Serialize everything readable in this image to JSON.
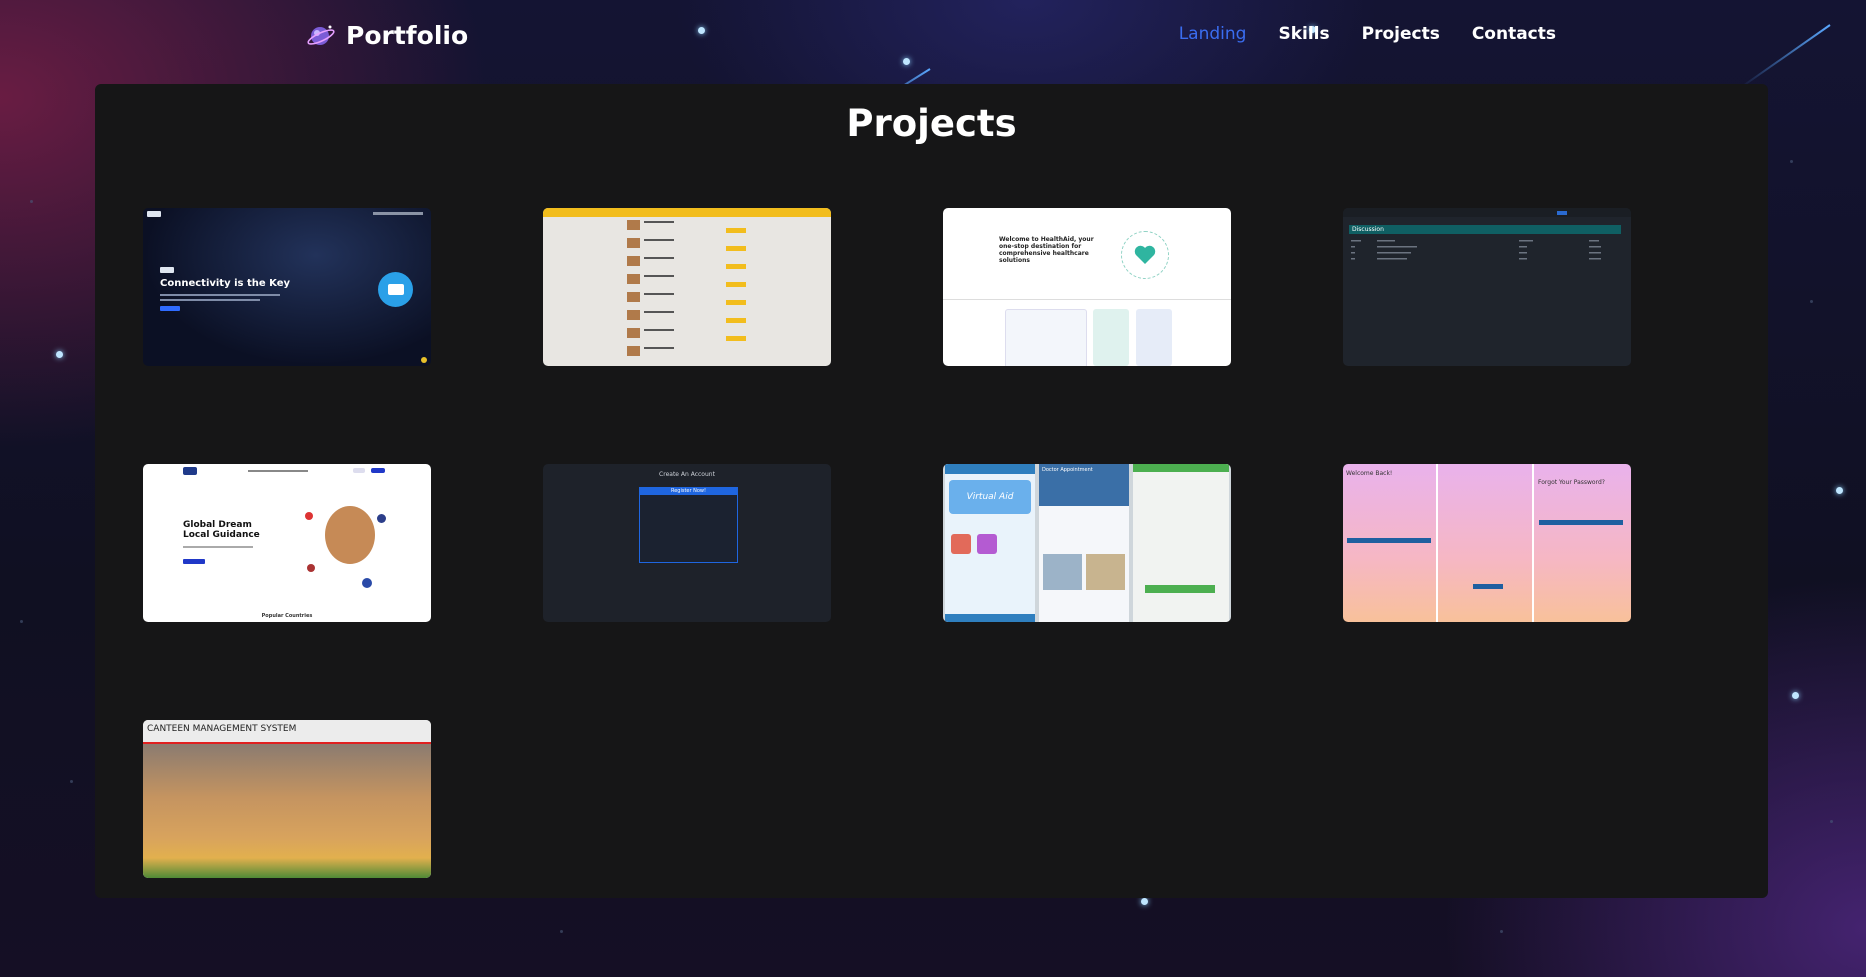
{
  "app": {
    "brand": "Portfolio"
  },
  "nav": {
    "items": [
      {
        "label": "Landing",
        "active": true
      },
      {
        "label": "Skills",
        "active": false
      },
      {
        "label": "Projects",
        "active": false
      },
      {
        "label": "Contacts",
        "active": false
      }
    ]
  },
  "section": {
    "title": "Projects"
  },
  "projects": [
    {
      "thumb_heading": "Connectivity is the Key"
    },
    {
      "thumb_heading": ""
    },
    {
      "thumb_heading": "Welcome to HealthAid, your one-stop destination for comprehensive healthcare solutions"
    },
    {
      "thumb_heading": "Discussion"
    },
    {
      "thumb_heading": "Global Dream Local Guidance",
      "thumb_footer": "Popular Countries"
    },
    {
      "thumb_heading": "Create An Account",
      "thumb_sub": "Register Now!"
    },
    {
      "thumb_heading": "Virtual Aid",
      "thumb_sub": "Doctor Appointment"
    },
    {
      "thumb_heading": "Welcome Back!",
      "thumb_sub": "Forgot Your Password?"
    },
    {
      "thumb_heading": "CANTEEN MANAGEMENT SYSTEM"
    }
  ],
  "colors": {
    "accent": "#3a6df0",
    "panel": "#161617",
    "star": "#bfe6ff"
  }
}
